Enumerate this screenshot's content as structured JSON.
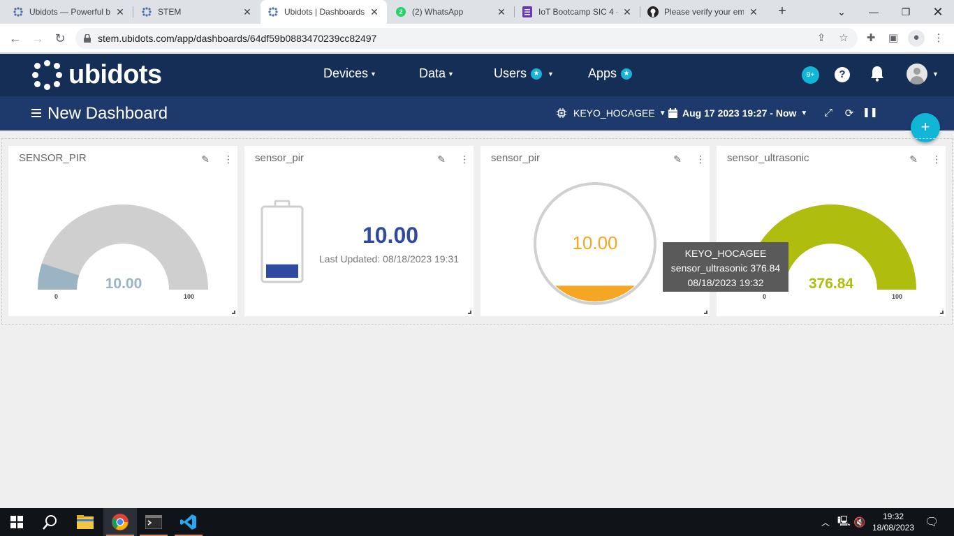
{
  "browser": {
    "tabs": [
      {
        "title": "Ubidots — Powerful b",
        "icon": "ubidots-icon"
      },
      {
        "title": "STEM",
        "icon": "ubidots-icon"
      },
      {
        "title": "Ubidots | Dashboards",
        "icon": "ubidots-icon"
      },
      {
        "title": "(2) WhatsApp",
        "icon": "whatsapp-icon",
        "badge": "2"
      },
      {
        "title": "IoT Bootcamp SIC 4 -",
        "icon": "forms-icon"
      },
      {
        "title": "Please verify your ema",
        "icon": "github-icon"
      }
    ],
    "url": "stem.ubidots.com/app/dashboards/64df59b0883470239cc82497"
  },
  "header": {
    "brand": "ubidots",
    "nav": [
      {
        "label": "Devices"
      },
      {
        "label": "Data"
      },
      {
        "label": "Users"
      },
      {
        "label": "Apps"
      }
    ],
    "notifications_badge": "9+",
    "help": "?"
  },
  "dashboard": {
    "title": "New Dashboard",
    "device_selector": "KEYO_HOCAGEE",
    "date_range": "Aug 17 2023 19:27 - Now",
    "add": "+"
  },
  "widgets": [
    {
      "title": "SENSOR_PIR",
      "type": "gauge",
      "value": "10.00",
      "min": "0",
      "max": "100",
      "fill_fraction": 0.1,
      "color": "#9bb4c3"
    },
    {
      "title": "sensor_pir",
      "type": "battery",
      "value": "10.00",
      "last_updated": "Last Updated: 08/18/2023 19:31",
      "fill_fraction": 0.1,
      "color": "#2f4aa0"
    },
    {
      "title": "sensor_pir",
      "type": "tank",
      "value": "10.00",
      "fill_fraction": 0.1,
      "color": "#f5a623"
    },
    {
      "title": "sensor_ultrasonic",
      "type": "gauge",
      "value": "376.84",
      "min": "0",
      "max": "100",
      "fill_fraction": 1.0,
      "color": "#aebd0e"
    }
  ],
  "tooltip": {
    "line1": "KEYO_HOCAGEE",
    "line2": "sensor_ultrasonic 376.84",
    "line3": "08/18/2023 19:32"
  },
  "taskbar": {
    "time": "19:32",
    "date": "18/08/2023",
    "apps": [
      "start-icon",
      "search-icon",
      "file-explorer-icon",
      "chrome-icon",
      "terminal-icon",
      "vscode-icon"
    ]
  }
}
